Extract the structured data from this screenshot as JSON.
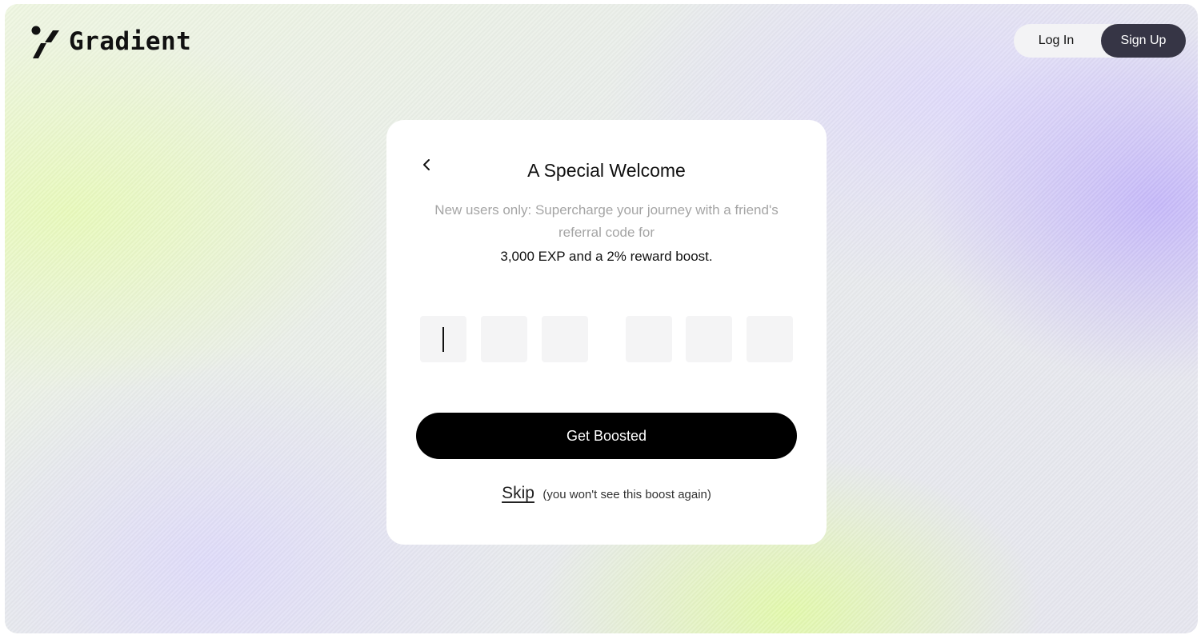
{
  "brand": {
    "name": "Gradient",
    "logo_icon": "gradient-logo-icon"
  },
  "header": {
    "login_label": "Log In",
    "signup_label": "Sign Up"
  },
  "card": {
    "back_icon": "chevron-left-icon",
    "title": "A Special Welcome",
    "subtitle": "New users only: Supercharge your journey with a friend's referral code for",
    "highlight": "3,000 EXP and a 2% reward boost.",
    "code_inputs": [
      "",
      "",
      "",
      "",
      "",
      ""
    ],
    "cta_label": "Get Boosted",
    "skip_label": "Skip",
    "skip_note": "(you won't see this boost again)"
  },
  "colors": {
    "primary_button": "#000000",
    "signup_button": "#363545",
    "muted_text": "#a5a5a5",
    "input_bg": "#f4f4f5"
  }
}
